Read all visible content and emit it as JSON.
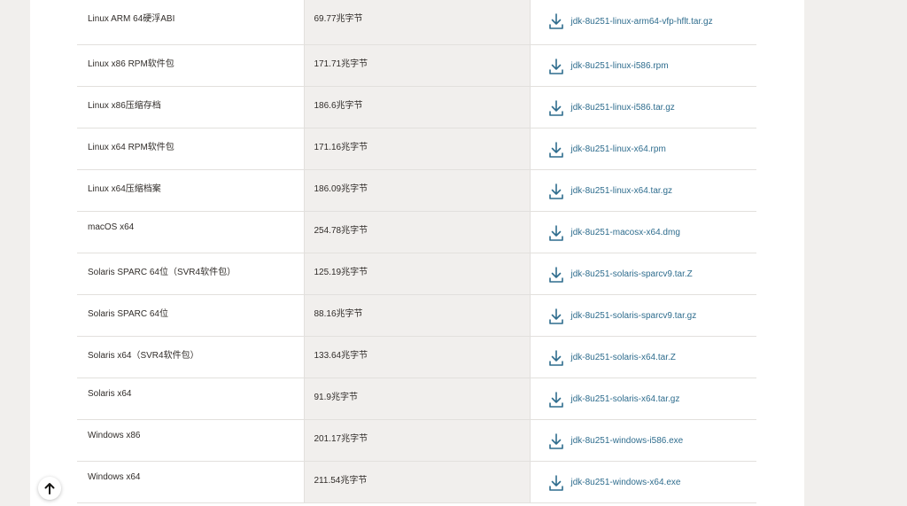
{
  "downloads": {
    "rows": [
      {
        "product": "Linux ARM 64硬浮ABI",
        "size": "69.77兆字节",
        "file": "jdk-8u251-linux-arm64-vfp-hflt.tar.gz"
      },
      {
        "product": "Linux x86 RPM软件包",
        "size": "171.71兆字节",
        "file": "jdk-8u251-linux-i586.rpm"
      },
      {
        "product": "Linux x86压缩存档",
        "size": "186.6兆字节",
        "file": "jdk-8u251-linux-i586.tar.gz"
      },
      {
        "product": "Linux x64 RPM软件包",
        "size": "171.16兆字节",
        "file": "jdk-8u251-linux-x64.rpm"
      },
      {
        "product": "Linux x64压缩档案",
        "size": "186.09兆字节",
        "file": "jdk-8u251-linux-x64.tar.gz"
      },
      {
        "product": "macOS x64",
        "size": "254.78兆字节",
        "file": "jdk-8u251-macosx-x64.dmg"
      },
      {
        "product": "Solaris SPARC 64位（SVR4软件包）",
        "size": "125.19兆字节",
        "file": "jdk-8u251-solaris-sparcv9.tar.Z"
      },
      {
        "product": "Solaris SPARC 64位",
        "size": "88.16兆字节",
        "file": "jdk-8u251-solaris-sparcv9.tar.gz"
      },
      {
        "product": "Solaris x64（SVR4软件包）",
        "size": "133.64兆字节",
        "file": "jdk-8u251-solaris-x64.tar.Z"
      },
      {
        "product": "Solaris x64",
        "size": "91.9兆字节",
        "file": "jdk-8u251-solaris-x64.tar.gz"
      },
      {
        "product": "Windows x86",
        "size": "201.17兆字节",
        "file": "jdk-8u251-windows-i586.exe"
      },
      {
        "product": "Windows x64",
        "size": "211.54兆字节",
        "file": "jdk-8u251-windows-x64.exe"
      }
    ]
  },
  "icons": {
    "download": "download-icon",
    "back_to_top": "arrow-up-icon"
  },
  "colors": {
    "link": "#2f6d8e",
    "text": "#312d2a",
    "size_column_bg": "#f1efed",
    "page_bg": "#f1efed"
  }
}
